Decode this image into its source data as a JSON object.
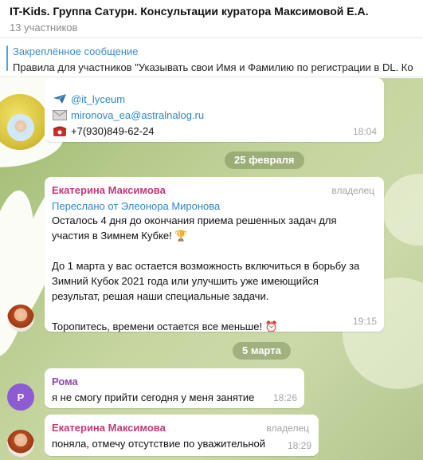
{
  "header": {
    "title": "IT-Kids. Группа Сатурн. Консультации куратора Максимовой Е.А.",
    "subtitle": "13 участников"
  },
  "pinned": {
    "title": "Закреплённое сообщение",
    "text": "Правила для участников \"Указывать свои Имя и Фамилию по регистрации в DL. Ко"
  },
  "messages": [
    {
      "contacts": {
        "telegram": "@it_lyceum",
        "email": "mironova_ea@astralnalog.ru",
        "phone": "+7(930)849-62-24"
      },
      "time": "18:04"
    },
    {
      "date": "25 февраля"
    },
    {
      "sender": "Екатерина Максимова",
      "role": "владелец",
      "forwarded": "Переслано от Элеонора Миронова",
      "lines": [
        "Осталось 4 дня до окончания приема решенных задач для",
        "участия в Зимнем Кубке! 🏆",
        "",
        "До 1 марта у вас остается возможность включиться в борьбу за",
        "Зимний Кубок 2021 года или улучшить уже имеющийся",
        "результат, решая наши специальные задачи.",
        "",
        "Торопитесь, времени остается все меньше! ⏰"
      ],
      "time": "19:15"
    },
    {
      "date": "5 марта"
    },
    {
      "sender": "Рома",
      "avatar_letter": "Р",
      "text": "я не смогу прийти сегодня у меня занятие",
      "time": "18:26"
    },
    {
      "sender": "Екатерина Максимова",
      "role": "владелец",
      "text": "поняла, отмечу отсутствие по уважительной",
      "time": "18:29"
    }
  ],
  "colors": {
    "accent": "#2f86c9",
    "owner_name": "#c2387a",
    "roma_name": "#8e44ad"
  }
}
